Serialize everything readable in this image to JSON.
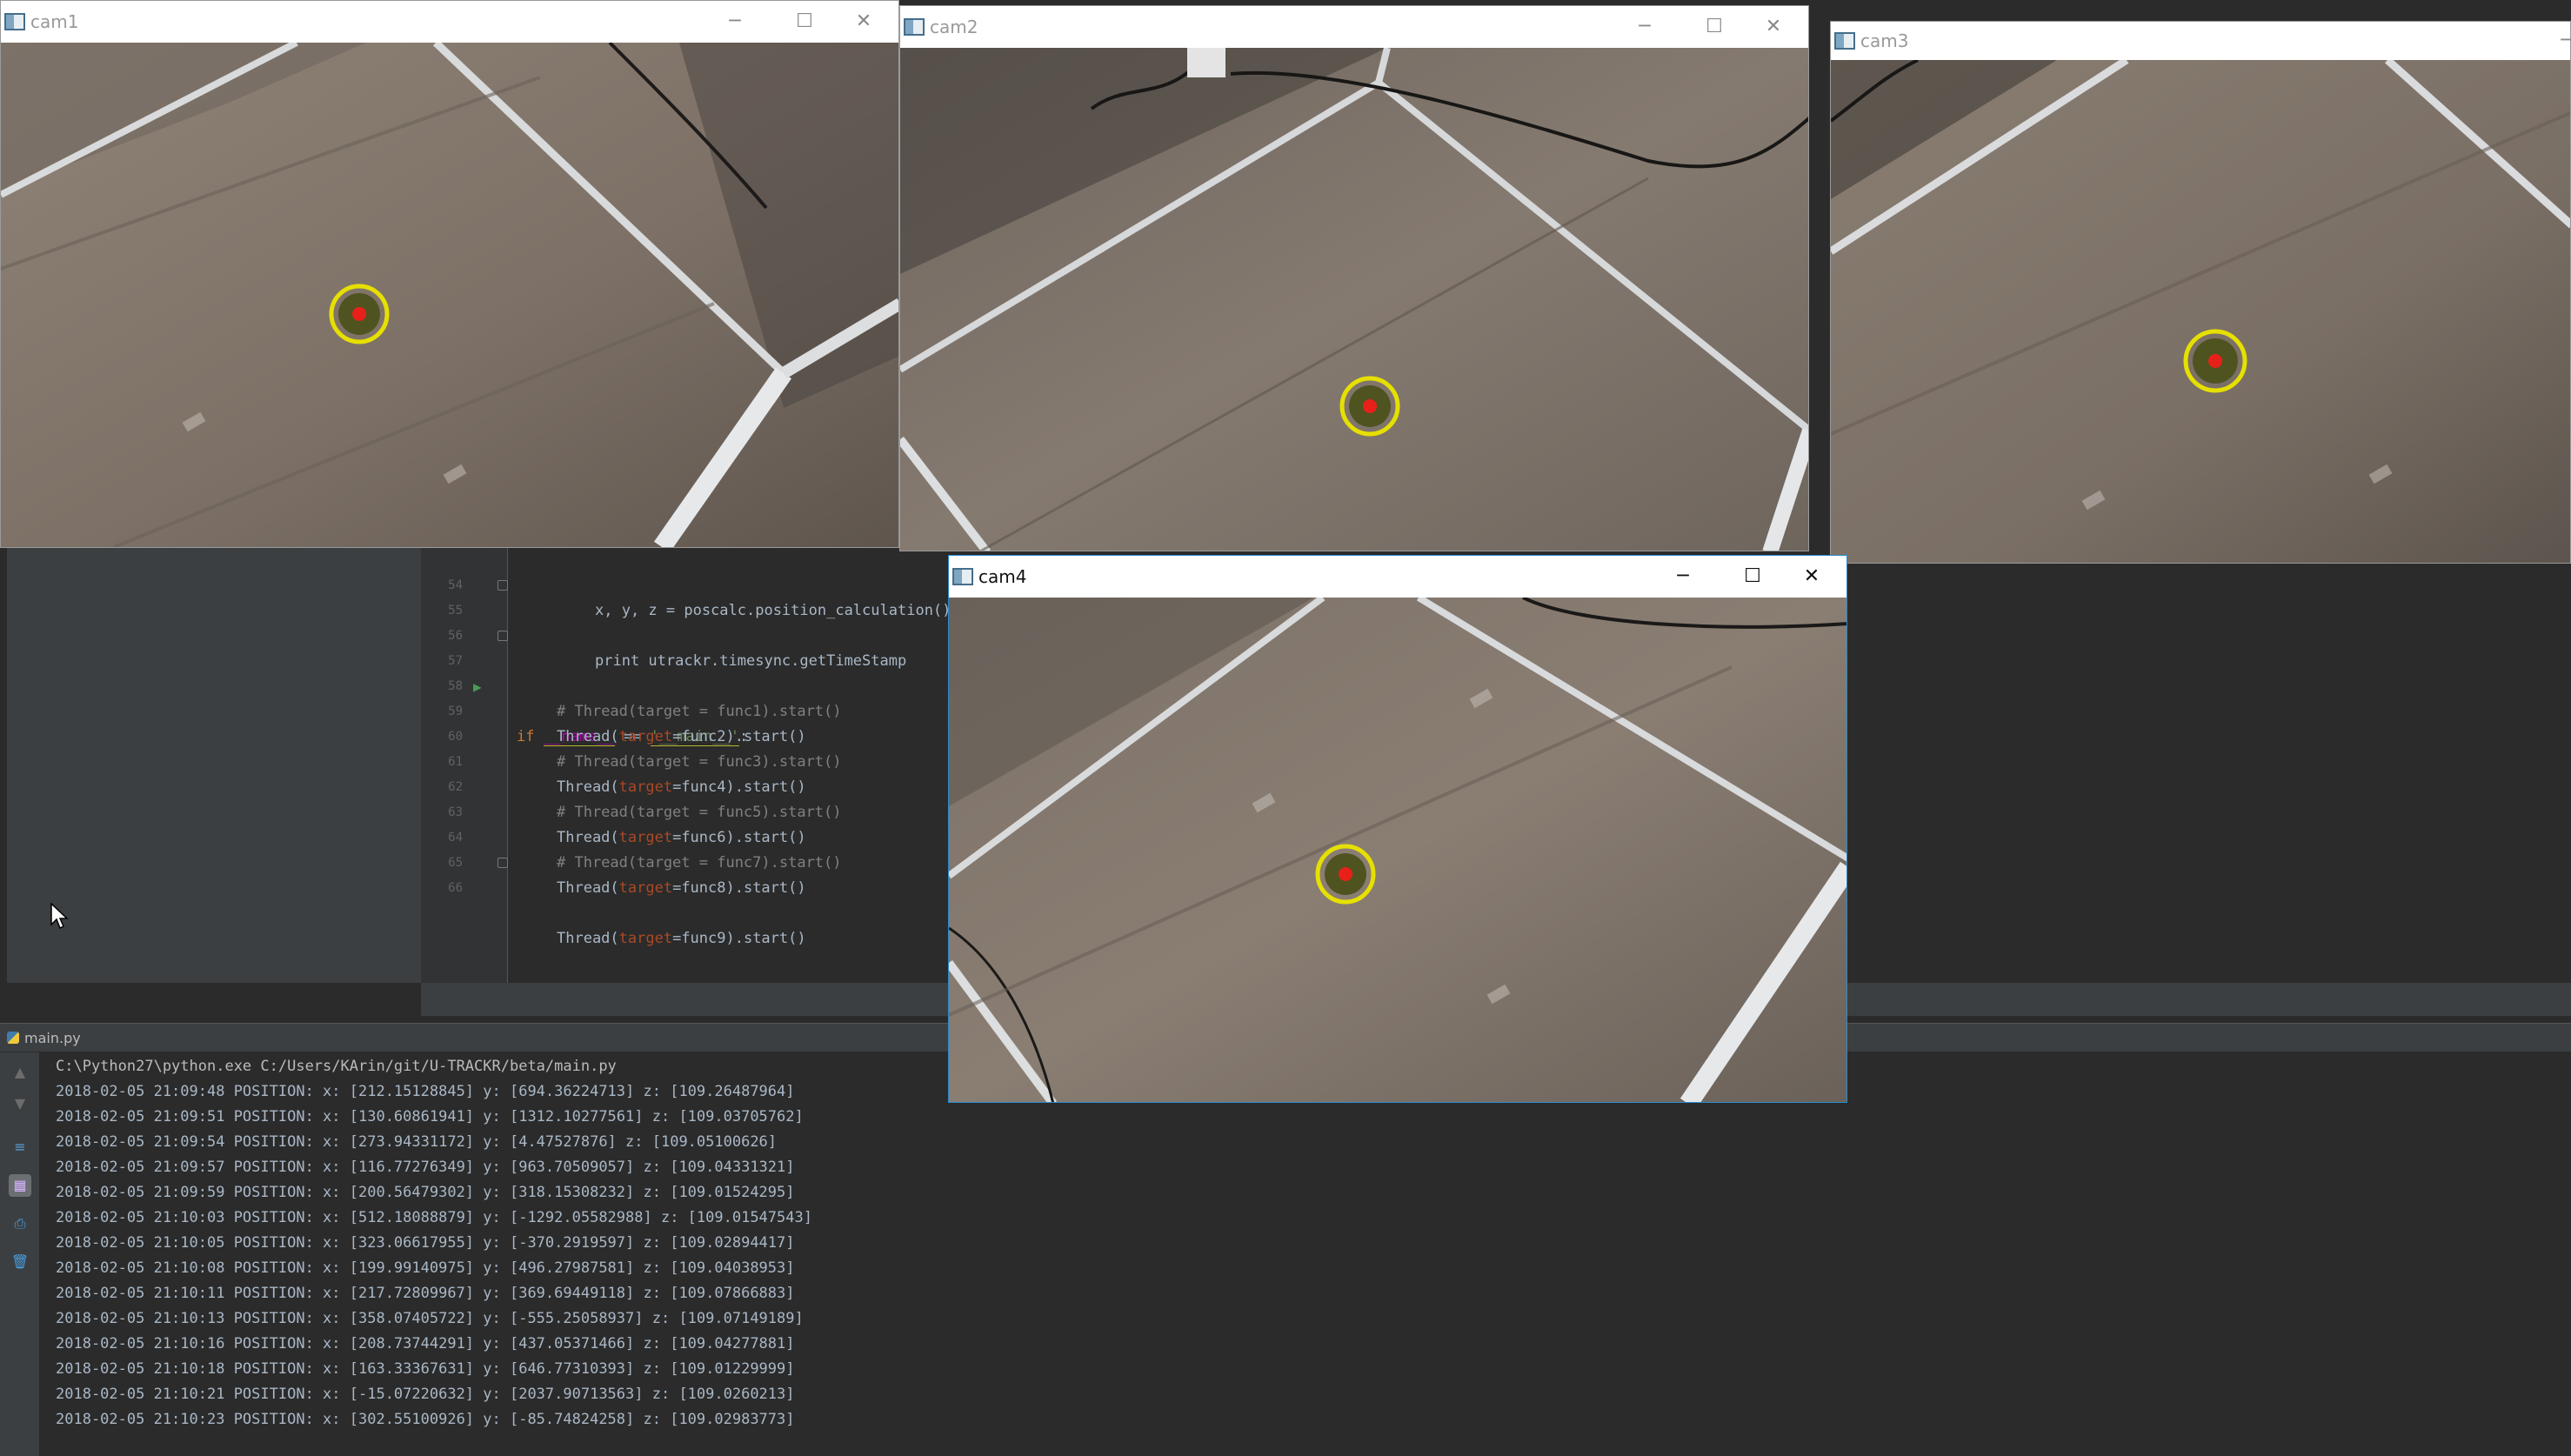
{
  "windows": [
    {
      "title": "cam1",
      "minimize": "─",
      "maximize": "☐",
      "close": "✕"
    },
    {
      "title": "cam2",
      "minimize": "─",
      "maximize": "☐",
      "close": "✕"
    },
    {
      "title": "cam3",
      "minimize": "─"
    },
    {
      "title": "cam4",
      "minimize": "─",
      "maximize": "☐",
      "close": "✕"
    }
  ],
  "editor": {
    "lines": [
      {
        "num": "54",
        "text": "x, y, z = poscalc.position_calculation()"
      },
      {
        "num": "55",
        "text": "print utrackr.timesync.getTimeStamp"
      },
      {
        "num": "56",
        "text": ""
      },
      {
        "num": "57",
        "kw": "if",
        "name": "__name__",
        "op": " == ",
        "str": "'__main__'",
        "end": ":"
      },
      {
        "num": "58",
        "comment": "# Thread(target = func1).start()"
      },
      {
        "num": "59",
        "fn": "Thread(",
        "arg": "target",
        "rest": "=func2).start()"
      },
      {
        "num": "60",
        "comment": "# Thread(target = func3).start()"
      },
      {
        "num": "61",
        "fn": "Thread(",
        "arg": "target",
        "rest": "=func4).start()"
      },
      {
        "num": "62",
        "comment": "# Thread(target = func5).start()"
      },
      {
        "num": "63",
        "fn": "Thread(",
        "arg": "target",
        "rest": "=func6).start()"
      },
      {
        "num": "64",
        "comment": "# Thread(target = func7).start()"
      },
      {
        "num": "65",
        "fn": "Thread(",
        "arg": "target",
        "rest": "=func8).start()"
      },
      {
        "num": "66",
        "fn": "Thread(",
        "arg": "target",
        "rest": "=func9).start()"
      }
    ]
  },
  "run": {
    "tab": "main.py",
    "command": "C:\\Python27\\python.exe C:/Users/KArin/git/U-TRACKR/beta/main.py",
    "log": [
      "2018-02-05 21:09:48 POSITION: x: [212.15128845] y: [694.36224713] z: [109.26487964]",
      "2018-02-05 21:09:51 POSITION: x: [130.60861941] y: [1312.10277561] z: [109.03705762]",
      "2018-02-05 21:09:54 POSITION: x: [273.94331172] y: [4.47527876] z: [109.05100626]",
      "2018-02-05 21:09:57 POSITION: x: [116.77276349] y: [963.70509057] z: [109.04331321]",
      "2018-02-05 21:09:59 POSITION: x: [200.56479302] y: [318.15308232] z: [109.01524295]",
      "2018-02-05 21:10:03 POSITION: x: [512.18088879] y: [-1292.05582988] z: [109.01547543]",
      "2018-02-05 21:10:05 POSITION: x: [323.06617955] y: [-370.2919597] z: [109.02894417]",
      "2018-02-05 21:10:08 POSITION: x: [199.99140975] y: [496.27987581] z: [109.04038953]",
      "2018-02-05 21:10:11 POSITION: x: [217.72809967] y: [369.69449118] z: [109.07866883]",
      "2018-02-05 21:10:13 POSITION: x: [358.07405722] y: [-555.25058937] z: [109.07149189]",
      "2018-02-05 21:10:16 POSITION: x: [208.73744291] y: [437.05371466] z: [109.04277881]",
      "2018-02-05 21:10:18 POSITION: x: [163.33367631] y: [646.77310393] z: [109.01229999]",
      "2018-02-05 21:10:21 POSITION: x: [-15.07220632] y: [2037.90713563] z: [109.0260213]",
      "2018-02-05 21:10:23 POSITION: x: [302.55100926] y: [-85.74824258] z: [109.02983773]"
    ]
  },
  "colors": {
    "marker_ring": "#e6e000",
    "marker_dot": "#e8201a",
    "ide_bg": "#2b2b2b",
    "active_window_border": "#2b8bcf"
  },
  "icons": [
    "opencv-window-icon",
    "python-file-icon",
    "run-gutter-icon",
    "mouse-cursor-icon"
  ]
}
